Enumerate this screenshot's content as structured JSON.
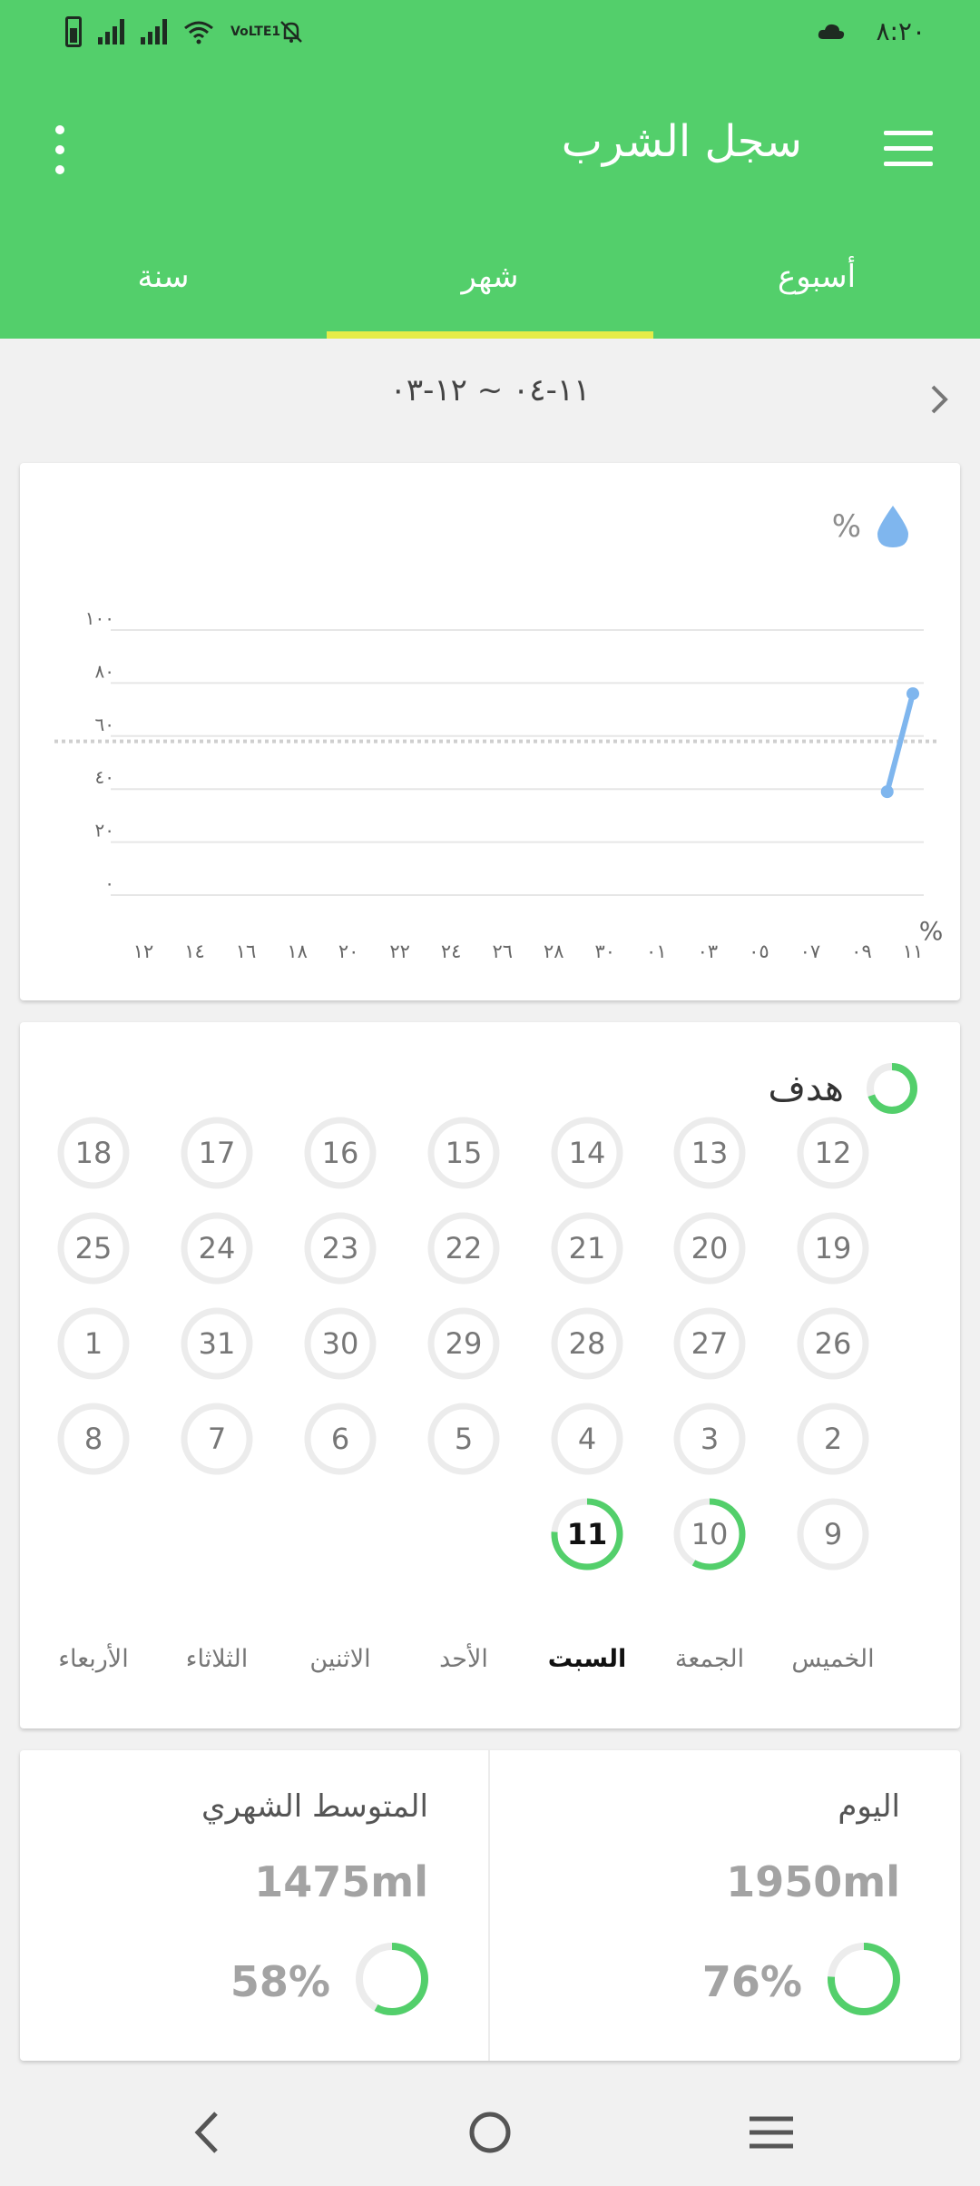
{
  "status_bar": {
    "time": "٨:٢٠",
    "icons": [
      "battery-icon",
      "signal-icon",
      "signal-icon",
      "wifi-icon",
      "volte-icon",
      "mute-icon",
      "cloud-icon"
    ],
    "volte_text": "VoLTE1"
  },
  "toolbar": {
    "title": "سجل الشرب"
  },
  "tabs": [
    {
      "label": "أسبوع",
      "active": false
    },
    {
      "label": "شهر",
      "active": true
    },
    {
      "label": "سنة",
      "active": false
    }
  ],
  "range": {
    "label": "١١-٠٤ ~ ١٢-٠٣"
  },
  "chart": {
    "legend": "%",
    "unit_label": "%"
  },
  "chart_data": {
    "type": "line",
    "x": [
      "١٢",
      "١٤",
      "١٦",
      "١٨",
      "٢٠",
      "٢٢",
      "٢٤",
      "٢٦",
      "٢٨",
      "٣٠",
      "٠١",
      "٠٣",
      "٠٥",
      "٠٧",
      "٠٩",
      "١١"
    ],
    "y_ticks": [
      "٠",
      "٢٠",
      "٤٠",
      "٦٠",
      "٨٠",
      "١٠٠"
    ],
    "ylim": [
      0,
      100
    ],
    "series": [
      {
        "points": [
          {
            "x": "10",
            "y": 39
          },
          {
            "x": "11",
            "y": 76
          }
        ],
        "color": "#7fb6ee"
      }
    ],
    "goal_line": 58,
    "grid": true
  },
  "goal": {
    "title": "هدف",
    "days": [
      [
        "12",
        "13",
        "14",
        "15",
        "16",
        "17",
        "18"
      ],
      [
        "19",
        "20",
        "21",
        "22",
        "23",
        "24",
        "25"
      ],
      [
        "26",
        "27",
        "28",
        "29",
        "30",
        "31",
        "1"
      ],
      [
        "2",
        "3",
        "4",
        "5",
        "6",
        "7",
        "8"
      ],
      [
        "9",
        "10",
        "11"
      ]
    ],
    "progress": {
      "10": 0.58,
      "11": 0.76
    },
    "today": "11",
    "weekdays": [
      "الخميس",
      "الجمعة",
      "السبت",
      "الأحد",
      "الاثنين",
      "الثلاثاء",
      "الأربعاء"
    ],
    "active_weekday": "السبت"
  },
  "stats": {
    "today": {
      "label": "اليوم",
      "value": "1950ml",
      "percent": "76%",
      "fraction": 0.76
    },
    "monthly": {
      "label": "المتوسط الشهري",
      "value": "1475ml",
      "percent": "58%",
      "fraction": 0.58
    }
  },
  "colors": {
    "primary": "#53cf6b",
    "tab_indicator": "#e5ec48",
    "line": "#7fb6ee",
    "ring": "#53cf6b",
    "ring_track": "#ececec"
  }
}
